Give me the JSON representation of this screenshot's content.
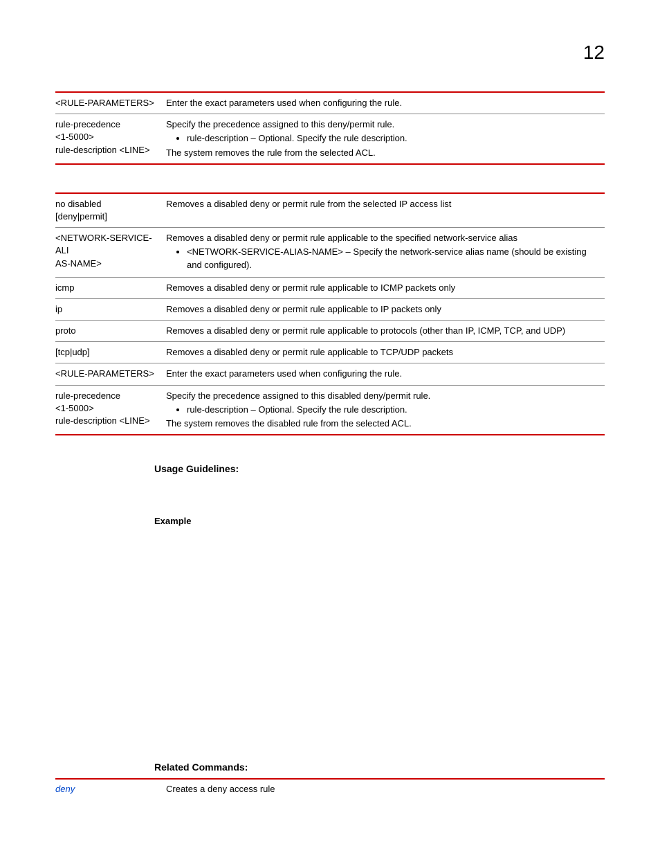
{
  "page_number": "12",
  "table1": {
    "rows": [
      {
        "c1": "<RULE-PARAMETERS>",
        "c2": "Enter the exact parameters used when configuring the rule."
      },
      {
        "c1_line1": "rule-precedence",
        "c1_line2": "<1-5000>",
        "c1_line3": "rule-description <LINE>",
        "c2_line1": "Specify the precedence assigned to this deny/permit rule.",
        "c2_bullet": "rule-description – Optional. Specify the rule description.",
        "c2_line3": "The system removes the rule from the selected ACL."
      }
    ]
  },
  "table2": {
    "rows": [
      {
        "c1_line1": "no disabled",
        "c1_line2": "[deny|permit]",
        "c2": "Removes a disabled deny or permit rule from the selected IP access list"
      },
      {
        "c1_line1": "<NETWORK-SERVICE-ALI",
        "c1_line2": "AS-NAME>",
        "c2_line1": "Removes a disabled deny or permit rule applicable to the specified network-service alias",
        "c2_bullet": "<NETWORK-SERVICE-ALIAS-NAME> – Specify the network-service alias name (should be existing and configured)."
      },
      {
        "c1": "icmp",
        "c2": "Removes a disabled deny or permit rule applicable to ICMP packets only"
      },
      {
        "c1": "ip",
        "c2": "Removes a disabled deny or permit rule applicable to IP packets only"
      },
      {
        "c1": "proto",
        "c2": "Removes a disabled deny or permit rule applicable to protocols (other than IP, ICMP, TCP, and UDP)"
      },
      {
        "c1": "[tcp|udp]",
        "c2": "Removes a disabled deny or permit rule applicable to TCP/UDP packets"
      },
      {
        "c1": "<RULE-PARAMETERS>",
        "c2": "Enter the exact parameters used when configuring the rule."
      },
      {
        "c1_line1": "rule-precedence",
        "c1_line2": "<1-5000>",
        "c1_line3": "rule-description <LINE>",
        "c2_line1": "Specify the precedence assigned to this disabled deny/permit rule.",
        "c2_bullet": "rule-description – Optional. Specify the rule description.",
        "c2_line3": "The system removes the disabled rule from the selected ACL."
      }
    ]
  },
  "headings": {
    "usage": "Usage Guidelines:",
    "example": "Example",
    "related": "Related Commands:"
  },
  "related": {
    "cmd": "deny",
    "desc": "Creates a deny access rule"
  }
}
